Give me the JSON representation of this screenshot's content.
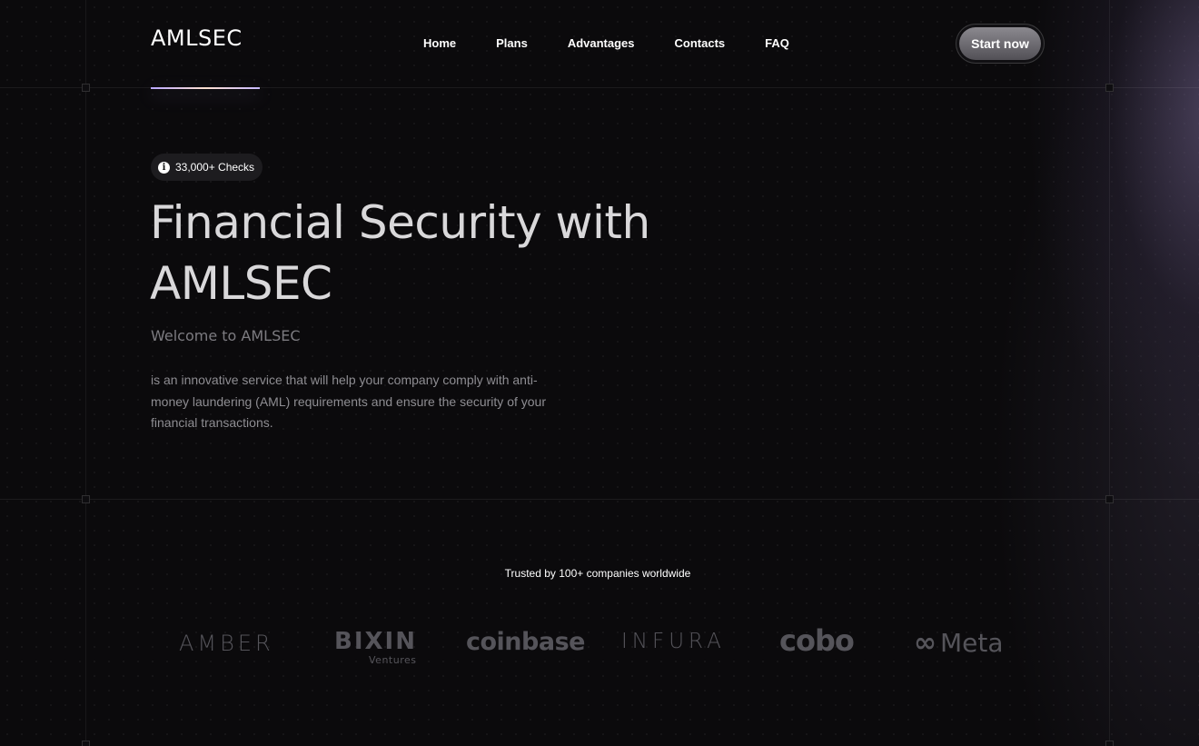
{
  "header": {
    "logo": "AMLSEC",
    "nav": [
      "Home",
      "Plans",
      "Advantages",
      "Contacts",
      "FAQ"
    ],
    "cta": "Start now"
  },
  "hero": {
    "badge_icon": "info-icon",
    "badge": "33,000+ Checks",
    "title": "Financial Security with AMLSEC",
    "subtitle": "Welcome to AMLSEC",
    "description": "is an innovative service that will help your company comply with anti-money laundering (AML) requirements and ensure the security of your financial transactions."
  },
  "trusted": {
    "heading": "Trusted by 100+ companies worldwide",
    "logos": {
      "amber": "AMBER",
      "bixin": "BIXIN",
      "bixin_sub": "Ventures",
      "coinbase": "coinbase",
      "infura": "INFURA",
      "cobo": "cobo",
      "meta": "Meta"
    }
  },
  "colors": {
    "background": "#0b0a0c",
    "accent_glow": "#7869a0",
    "logo_gray": "#55545a"
  }
}
